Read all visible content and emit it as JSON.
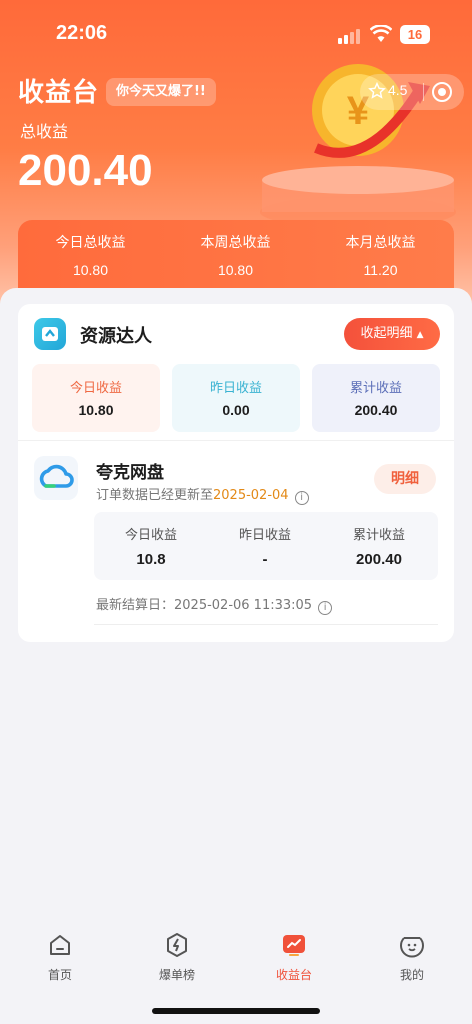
{
  "status_bar": {
    "time": "22:06",
    "battery": "16"
  },
  "header": {
    "brand": "收益台",
    "slogan": "你今天又爆了!!",
    "rating": "4.5",
    "total_label": "总收益",
    "total_value": "200.40"
  },
  "summary": [
    {
      "label": "今日总收益",
      "value": "10.80"
    },
    {
      "label": "本周总收益",
      "value": "10.80"
    },
    {
      "label": "本月总收益",
      "value": "11.20"
    }
  ],
  "card": {
    "title": "资源达人",
    "collapse_label": "收起明细",
    "stats": [
      {
        "label": "今日收益",
        "value": "10.80"
      },
      {
        "label": "昨日收益",
        "value": "0.00"
      },
      {
        "label": "累计收益",
        "value": "200.40"
      }
    ],
    "app": {
      "name": "夸克网盘",
      "sub_prefix": "订单数据已经更新至",
      "sub_date": "2025-02-04",
      "detail_label": "明细",
      "stats": [
        {
          "label": "今日收益",
          "value": "10.8"
        },
        {
          "label": "昨日收益",
          "value": "-"
        },
        {
          "label": "累计收益",
          "value": "200.40"
        }
      ],
      "settle_text": "最新结算日：2025-02-06 11:33:05"
    }
  },
  "tabs": [
    {
      "label": "首页",
      "icon": "home-icon"
    },
    {
      "label": "爆单榜",
      "icon": "lightning-icon"
    },
    {
      "label": "收益台",
      "icon": "earnings-icon",
      "active": true
    },
    {
      "label": "我的",
      "icon": "profile-icon"
    }
  ],
  "colors": {
    "accent": "#f0513a",
    "header": "#ff6a3a",
    "date": "#e38a18"
  }
}
